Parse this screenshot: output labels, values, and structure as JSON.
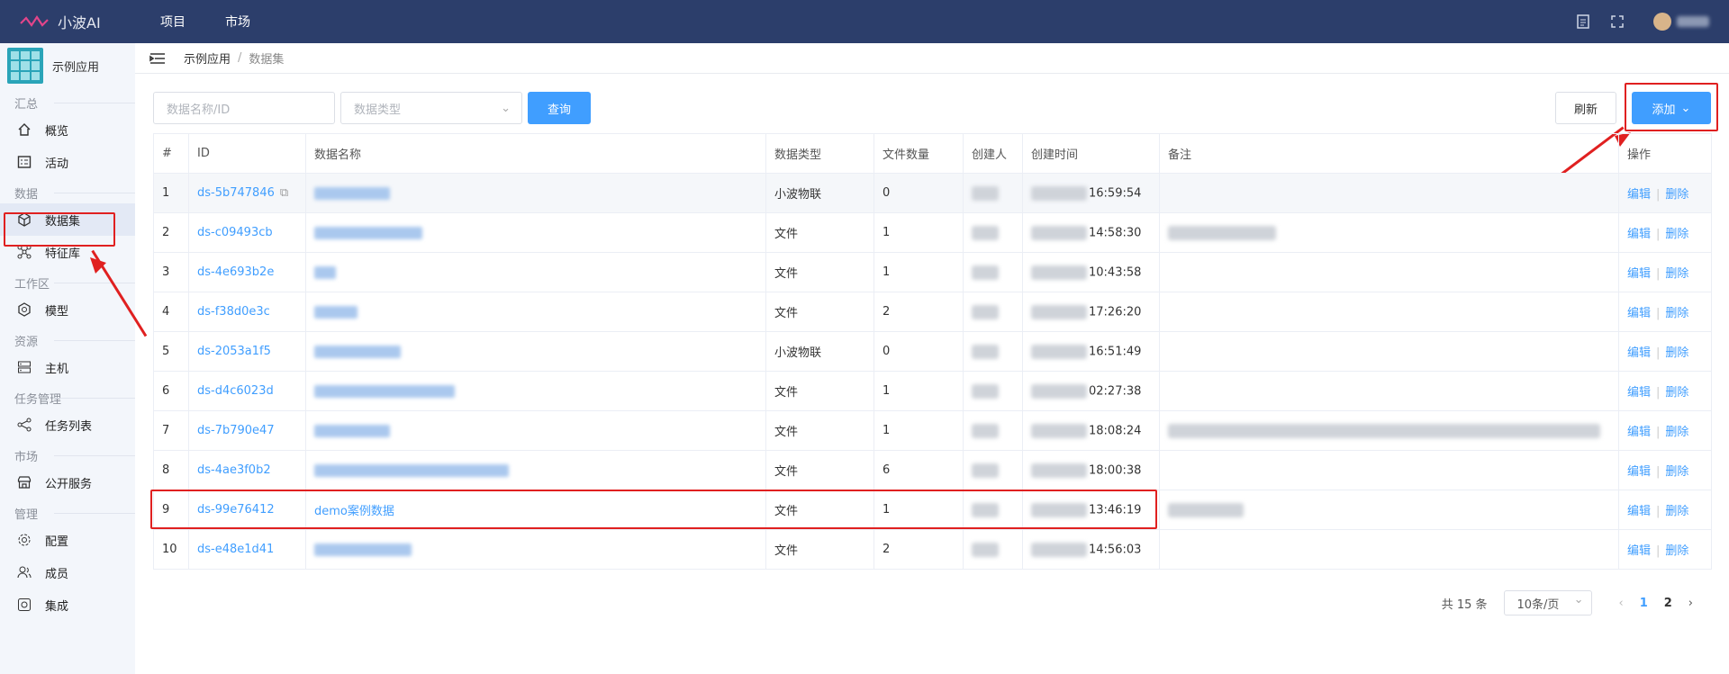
{
  "topbar": {
    "app_name": "小波AI",
    "nav": [
      "项目",
      "市场"
    ],
    "icons": [
      "document-icon",
      "fullscreen-icon",
      "avatar"
    ]
  },
  "sidebar": {
    "app_title": "示例应用",
    "groups": [
      {
        "label": "汇总",
        "items": [
          {
            "label": "概览",
            "icon": "home-icon"
          },
          {
            "label": "活动",
            "icon": "activity-icon"
          }
        ]
      },
      {
        "label": "数据",
        "items": [
          {
            "label": "数据集",
            "icon": "cube-icon",
            "active": true
          },
          {
            "label": "特征库",
            "icon": "network-icon"
          }
        ]
      },
      {
        "label": "工作区",
        "items": [
          {
            "label": "模型",
            "icon": "model-icon"
          }
        ]
      },
      {
        "label": "资源",
        "items": [
          {
            "label": "主机",
            "icon": "server-icon"
          }
        ]
      },
      {
        "label": "任务管理",
        "items": [
          {
            "label": "任务列表",
            "icon": "share-icon"
          }
        ]
      },
      {
        "label": "市场",
        "items": [
          {
            "label": "公开服务",
            "icon": "store-icon"
          }
        ]
      },
      {
        "label": "管理",
        "items": [
          {
            "label": "配置",
            "icon": "gear-icon"
          },
          {
            "label": "成员",
            "icon": "users-icon"
          },
          {
            "label": "集成",
            "icon": "integration-icon"
          }
        ]
      }
    ]
  },
  "breadcrumb": {
    "root": "示例应用",
    "sep": "/",
    "current": "数据集"
  },
  "toolbar": {
    "name_placeholder": "数据名称/ID",
    "type_placeholder": "数据类型",
    "query_label": "查询",
    "refresh_label": "刷新",
    "add_label": "添加"
  },
  "table": {
    "headers": [
      "#",
      "ID",
      "数据名称",
      "数据类型",
      "文件数量",
      "创建人",
      "创建时间",
      "备注",
      "操作"
    ],
    "rows": [
      {
        "no": "1",
        "id": "ds-5b747846",
        "name": "",
        "type": "小波物联",
        "files": "0",
        "time": "16:59:54",
        "edit": "编辑",
        "del": "删除"
      },
      {
        "no": "2",
        "id": "ds-c09493cb",
        "name": "",
        "type": "文件",
        "files": "1",
        "time": "14:58:30",
        "edit": "编辑",
        "del": "删除"
      },
      {
        "no": "3",
        "id": "ds-4e693b2e",
        "name": "",
        "type": "文件",
        "files": "1",
        "time": "10:43:58",
        "edit": "编辑",
        "del": "删除"
      },
      {
        "no": "4",
        "id": "ds-f38d0e3c",
        "name": "",
        "type": "文件",
        "files": "2",
        "time": "17:26:20",
        "edit": "编辑",
        "del": "删除"
      },
      {
        "no": "5",
        "id": "ds-2053a1f5",
        "name": "",
        "type": "小波物联",
        "files": "0",
        "time": "16:51:49",
        "edit": "编辑",
        "del": "删除"
      },
      {
        "no": "6",
        "id": "ds-d4c6023d",
        "name": "",
        "type": "文件",
        "files": "1",
        "time": "02:27:38",
        "edit": "编辑",
        "del": "删除"
      },
      {
        "no": "7",
        "id": "ds-7b790e47",
        "name": "",
        "type": "文件",
        "files": "1",
        "time": "18:08:24",
        "edit": "编辑",
        "del": "删除"
      },
      {
        "no": "8",
        "id": "ds-4ae3f0b2",
        "name": "",
        "type": "文件",
        "files": "6",
        "time": "18:00:38",
        "edit": "编辑",
        "del": "删除"
      },
      {
        "no": "9",
        "id": "ds-99e76412",
        "name": "demo案例数据",
        "type": "文件",
        "files": "1",
        "time": "13:46:19",
        "edit": "编辑",
        "del": "删除"
      },
      {
        "no": "10",
        "id": "ds-e48e1d41",
        "name": "",
        "type": "文件",
        "files": "2",
        "time": "14:56:03",
        "edit": "编辑",
        "del": "删除"
      }
    ]
  },
  "pager": {
    "total": "共 15 条",
    "page_size": "10条/页",
    "pages": [
      "1",
      "2"
    ],
    "current": "1"
  },
  "colors": {
    "topbar": "#2c3e6b",
    "accent": "#409eff",
    "highlight": "#e02020"
  }
}
